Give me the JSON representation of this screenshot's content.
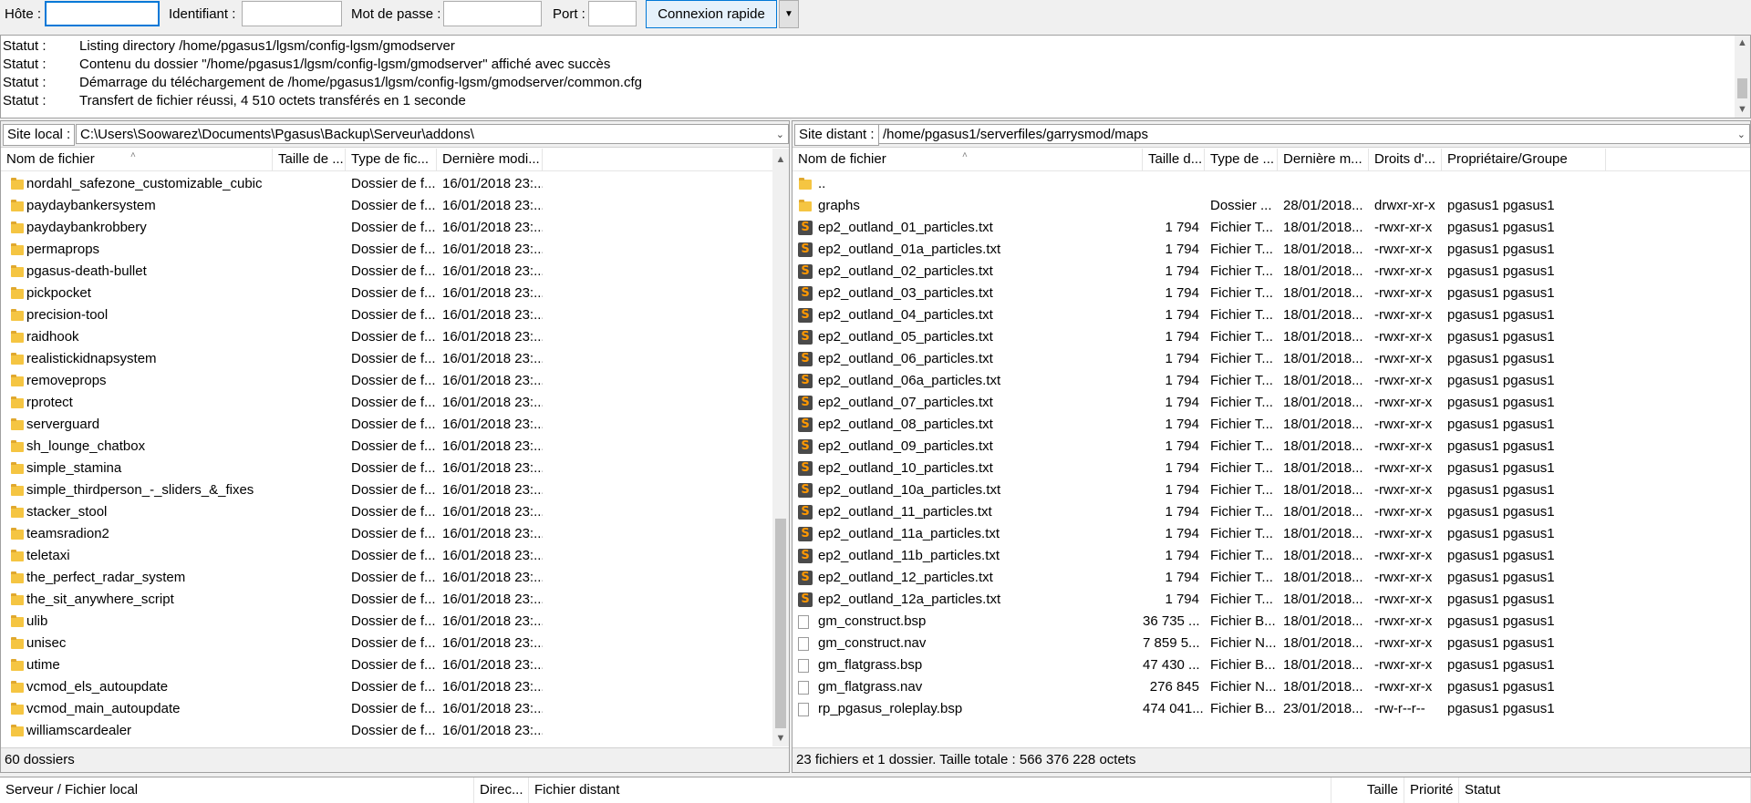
{
  "quickconnect": {
    "host_label": "Hôte :",
    "user_label": "Identifiant :",
    "pass_label": "Mot de passe :",
    "port_label": "Port :",
    "host_value": "",
    "user_value": "",
    "pass_value": "",
    "port_value": "",
    "connect_label": "Connexion rapide",
    "dropdown_icon": "chevron-down-icon"
  },
  "log": [
    {
      "k": "Statut :",
      "v": "Listing directory /home/pgasus1/lgsm/config-lgsm/gmodserver"
    },
    {
      "k": "Statut :",
      "v": "Contenu du dossier \"/home/pgasus1/lgsm/config-lgsm/gmodserver\" affiché avec succès"
    },
    {
      "k": "Statut :",
      "v": "Démarrage du téléchargement de /home/pgasus1/lgsm/config-lgsm/gmodserver/common.cfg"
    },
    {
      "k": "Statut :",
      "v": "Transfert de fichier réussi, 4 510 octets transférés en 1 seconde"
    }
  ],
  "local": {
    "site_label": "Site local :",
    "path": "C:\\Users\\Soowarez\\Documents\\Pgasus\\Backup\\Serveur\\addons\\",
    "columns": [
      "Nom de fichier",
      "Taille de ...",
      "Type de fic...",
      "Dernière modi..."
    ],
    "rows": [
      {
        "name": "nordahl_safezone_customizable_cubic",
        "size": "",
        "type": "Dossier de f...",
        "date": "16/01/2018 23:..."
      },
      {
        "name": "paydaybankersystem",
        "size": "",
        "type": "Dossier de f...",
        "date": "16/01/2018 23:..."
      },
      {
        "name": "paydaybankrobbery",
        "size": "",
        "type": "Dossier de f...",
        "date": "16/01/2018 23:..."
      },
      {
        "name": "permaprops",
        "size": "",
        "type": "Dossier de f...",
        "date": "16/01/2018 23:..."
      },
      {
        "name": "pgasus-death-bullet",
        "size": "",
        "type": "Dossier de f...",
        "date": "16/01/2018 23:..."
      },
      {
        "name": "pickpocket",
        "size": "",
        "type": "Dossier de f...",
        "date": "16/01/2018 23:..."
      },
      {
        "name": "precision-tool",
        "size": "",
        "type": "Dossier de f...",
        "date": "16/01/2018 23:..."
      },
      {
        "name": "raidhook",
        "size": "",
        "type": "Dossier de f...",
        "date": "16/01/2018 23:..."
      },
      {
        "name": "realistickidnapsystem",
        "size": "",
        "type": "Dossier de f...",
        "date": "16/01/2018 23:..."
      },
      {
        "name": "removeprops",
        "size": "",
        "type": "Dossier de f...",
        "date": "16/01/2018 23:..."
      },
      {
        "name": "rprotect",
        "size": "",
        "type": "Dossier de f...",
        "date": "16/01/2018 23:..."
      },
      {
        "name": "serverguard",
        "size": "",
        "type": "Dossier de f...",
        "date": "16/01/2018 23:..."
      },
      {
        "name": "sh_lounge_chatbox",
        "size": "",
        "type": "Dossier de f...",
        "date": "16/01/2018 23:..."
      },
      {
        "name": "simple_stamina",
        "size": "",
        "type": "Dossier de f...",
        "date": "16/01/2018 23:..."
      },
      {
        "name": "simple_thirdperson_-_sliders_&_fixes",
        "size": "",
        "type": "Dossier de f...",
        "date": "16/01/2018 23:..."
      },
      {
        "name": "stacker_stool",
        "size": "",
        "type": "Dossier de f...",
        "date": "16/01/2018 23:..."
      },
      {
        "name": "teamsradion2",
        "size": "",
        "type": "Dossier de f...",
        "date": "16/01/2018 23:..."
      },
      {
        "name": "teletaxi",
        "size": "",
        "type": "Dossier de f...",
        "date": "16/01/2018 23:..."
      },
      {
        "name": "the_perfect_radar_system",
        "size": "",
        "type": "Dossier de f...",
        "date": "16/01/2018 23:..."
      },
      {
        "name": "the_sit_anywhere_script",
        "size": "",
        "type": "Dossier de f...",
        "date": "16/01/2018 23:..."
      },
      {
        "name": "ulib",
        "size": "",
        "type": "Dossier de f...",
        "date": "16/01/2018 23:..."
      },
      {
        "name": "unisec",
        "size": "",
        "type": "Dossier de f...",
        "date": "16/01/2018 23:..."
      },
      {
        "name": "utime",
        "size": "",
        "type": "Dossier de f...",
        "date": "16/01/2018 23:..."
      },
      {
        "name": "vcmod_els_autoupdate",
        "size": "",
        "type": "Dossier de f...",
        "date": "16/01/2018 23:..."
      },
      {
        "name": "vcmod_main_autoupdate",
        "size": "",
        "type": "Dossier de f...",
        "date": "16/01/2018 23:..."
      },
      {
        "name": "williamscardealer",
        "size": "",
        "type": "Dossier de f...",
        "date": "16/01/2018 23:..."
      }
    ],
    "status": "60 dossiers"
  },
  "remote": {
    "site_label": "Site distant :",
    "path": "/home/pgasus1/serverfiles/garrysmod/maps",
    "columns": [
      "Nom de fichier",
      "Taille d...",
      "Type de ...",
      "Dernière m...",
      "Droits d'...",
      "Propriétaire/Groupe"
    ],
    "rows": [
      {
        "icon": "folder",
        "name": "..",
        "size": "",
        "type": "",
        "date": "",
        "perm": "",
        "owner": ""
      },
      {
        "icon": "folder",
        "name": "graphs",
        "size": "",
        "type": "Dossier ...",
        "date": "28/01/2018...",
        "perm": "drwxr-xr-x",
        "owner": "pgasus1 pgasus1"
      },
      {
        "icon": "sub",
        "name": "ep2_outland_01_particles.txt",
        "size": "1 794",
        "type": "Fichier T...",
        "date": "18/01/2018...",
        "perm": "-rwxr-xr-x",
        "owner": "pgasus1 pgasus1"
      },
      {
        "icon": "sub",
        "name": "ep2_outland_01a_particles.txt",
        "size": "1 794",
        "type": "Fichier T...",
        "date": "18/01/2018...",
        "perm": "-rwxr-xr-x",
        "owner": "pgasus1 pgasus1"
      },
      {
        "icon": "sub",
        "name": "ep2_outland_02_particles.txt",
        "size": "1 794",
        "type": "Fichier T...",
        "date": "18/01/2018...",
        "perm": "-rwxr-xr-x",
        "owner": "pgasus1 pgasus1"
      },
      {
        "icon": "sub",
        "name": "ep2_outland_03_particles.txt",
        "size": "1 794",
        "type": "Fichier T...",
        "date": "18/01/2018...",
        "perm": "-rwxr-xr-x",
        "owner": "pgasus1 pgasus1"
      },
      {
        "icon": "sub",
        "name": "ep2_outland_04_particles.txt",
        "size": "1 794",
        "type": "Fichier T...",
        "date": "18/01/2018...",
        "perm": "-rwxr-xr-x",
        "owner": "pgasus1 pgasus1"
      },
      {
        "icon": "sub",
        "name": "ep2_outland_05_particles.txt",
        "size": "1 794",
        "type": "Fichier T...",
        "date": "18/01/2018...",
        "perm": "-rwxr-xr-x",
        "owner": "pgasus1 pgasus1"
      },
      {
        "icon": "sub",
        "name": "ep2_outland_06_particles.txt",
        "size": "1 794",
        "type": "Fichier T...",
        "date": "18/01/2018...",
        "perm": "-rwxr-xr-x",
        "owner": "pgasus1 pgasus1"
      },
      {
        "icon": "sub",
        "name": "ep2_outland_06a_particles.txt",
        "size": "1 794",
        "type": "Fichier T...",
        "date": "18/01/2018...",
        "perm": "-rwxr-xr-x",
        "owner": "pgasus1 pgasus1"
      },
      {
        "icon": "sub",
        "name": "ep2_outland_07_particles.txt",
        "size": "1 794",
        "type": "Fichier T...",
        "date": "18/01/2018...",
        "perm": "-rwxr-xr-x",
        "owner": "pgasus1 pgasus1"
      },
      {
        "icon": "sub",
        "name": "ep2_outland_08_particles.txt",
        "size": "1 794",
        "type": "Fichier T...",
        "date": "18/01/2018...",
        "perm": "-rwxr-xr-x",
        "owner": "pgasus1 pgasus1"
      },
      {
        "icon": "sub",
        "name": "ep2_outland_09_particles.txt",
        "size": "1 794",
        "type": "Fichier T...",
        "date": "18/01/2018...",
        "perm": "-rwxr-xr-x",
        "owner": "pgasus1 pgasus1"
      },
      {
        "icon": "sub",
        "name": "ep2_outland_10_particles.txt",
        "size": "1 794",
        "type": "Fichier T...",
        "date": "18/01/2018...",
        "perm": "-rwxr-xr-x",
        "owner": "pgasus1 pgasus1"
      },
      {
        "icon": "sub",
        "name": "ep2_outland_10a_particles.txt",
        "size": "1 794",
        "type": "Fichier T...",
        "date": "18/01/2018...",
        "perm": "-rwxr-xr-x",
        "owner": "pgasus1 pgasus1"
      },
      {
        "icon": "sub",
        "name": "ep2_outland_11_particles.txt",
        "size": "1 794",
        "type": "Fichier T...",
        "date": "18/01/2018...",
        "perm": "-rwxr-xr-x",
        "owner": "pgasus1 pgasus1"
      },
      {
        "icon": "sub",
        "name": "ep2_outland_11a_particles.txt",
        "size": "1 794",
        "type": "Fichier T...",
        "date": "18/01/2018...",
        "perm": "-rwxr-xr-x",
        "owner": "pgasus1 pgasus1"
      },
      {
        "icon": "sub",
        "name": "ep2_outland_11b_particles.txt",
        "size": "1 794",
        "type": "Fichier T...",
        "date": "18/01/2018...",
        "perm": "-rwxr-xr-x",
        "owner": "pgasus1 pgasus1"
      },
      {
        "icon": "sub",
        "name": "ep2_outland_12_particles.txt",
        "size": "1 794",
        "type": "Fichier T...",
        "date": "18/01/2018...",
        "perm": "-rwxr-xr-x",
        "owner": "pgasus1 pgasus1"
      },
      {
        "icon": "sub",
        "name": "ep2_outland_12a_particles.txt",
        "size": "1 794",
        "type": "Fichier T...",
        "date": "18/01/2018...",
        "perm": "-rwxr-xr-x",
        "owner": "pgasus1 pgasus1"
      },
      {
        "icon": "doc",
        "name": "gm_construct.bsp",
        "size": "36 735 ...",
        "type": "Fichier B...",
        "date": "18/01/2018...",
        "perm": "-rwxr-xr-x",
        "owner": "pgasus1 pgasus1"
      },
      {
        "icon": "doc",
        "name": "gm_construct.nav",
        "size": "7 859 5...",
        "type": "Fichier N...",
        "date": "18/01/2018...",
        "perm": "-rwxr-xr-x",
        "owner": "pgasus1 pgasus1"
      },
      {
        "icon": "doc",
        "name": "gm_flatgrass.bsp",
        "size": "47 430 ...",
        "type": "Fichier B...",
        "date": "18/01/2018...",
        "perm": "-rwxr-xr-x",
        "owner": "pgasus1 pgasus1"
      },
      {
        "icon": "doc",
        "name": "gm_flatgrass.nav",
        "size": "276 845",
        "type": "Fichier N...",
        "date": "18/01/2018...",
        "perm": "-rwxr-xr-x",
        "owner": "pgasus1 pgasus1"
      },
      {
        "icon": "doc",
        "name": "rp_pgasus_roleplay.bsp",
        "size": "474 041...",
        "type": "Fichier B...",
        "date": "23/01/2018...",
        "perm": "-rw-r--r--",
        "owner": "pgasus1 pgasus1"
      }
    ],
    "status": "23 fichiers et 1 dossier. Taille totale : 566 376 228 octets"
  },
  "queue": {
    "columns": [
      "Serveur / Fichier local",
      "Direc...",
      "Fichier distant",
      "Taille",
      "Priorité",
      "Statut"
    ]
  }
}
